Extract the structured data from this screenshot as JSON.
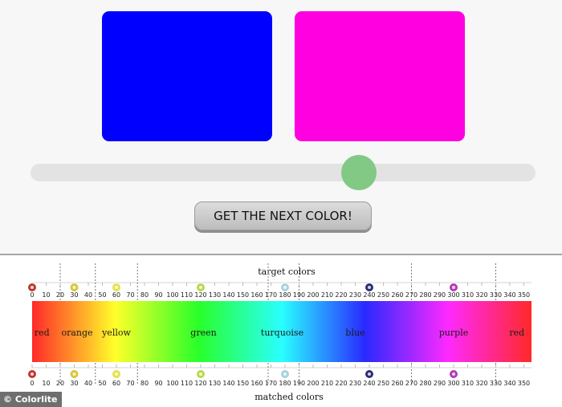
{
  "game": {
    "target_color": "#0000ff",
    "matched_color": "#ff00e0",
    "slider": {
      "value": 238,
      "min": 0,
      "max": 360,
      "thumb_color": "#82c986"
    },
    "next_button_label": "GET THE NEXT COLOR!"
  },
  "legend": {
    "top_title": "target colors",
    "bottom_title": "matched colors",
    "ticks": [
      0,
      10,
      20,
      30,
      40,
      50,
      60,
      70,
      80,
      90,
      100,
      110,
      120,
      130,
      140,
      150,
      160,
      170,
      180,
      190,
      200,
      210,
      220,
      230,
      240,
      250,
      260,
      270,
      280,
      290,
      300,
      310,
      320,
      330,
      340,
      350
    ],
    "boundaries": [
      20,
      45,
      75,
      168,
      190,
      270,
      330
    ],
    "hue_names": [
      {
        "label": "red",
        "hue": 7
      },
      {
        "label": "orange",
        "hue": 32
      },
      {
        "label": "yellow",
        "hue": 60
      },
      {
        "label": "green",
        "hue": 122
      },
      {
        "label": "turquoise",
        "hue": 178
      },
      {
        "label": "blue",
        "hue": 230
      },
      {
        "label": "purple",
        "hue": 300
      },
      {
        "label": "red",
        "hue": 345
      }
    ],
    "markers": [
      {
        "hue": 0,
        "color": "#c0392b"
      },
      {
        "hue": 30,
        "color": "#d6c63a"
      },
      {
        "hue": 60,
        "color": "#e3e34a"
      },
      {
        "hue": 120,
        "color": "#b8d94a"
      },
      {
        "hue": 180,
        "color": "#a7d3dc"
      },
      {
        "hue": 240,
        "color": "#2c2f78"
      },
      {
        "hue": 300,
        "color": "#b33bb5"
      }
    ]
  },
  "watermark": "© Colorlite"
}
